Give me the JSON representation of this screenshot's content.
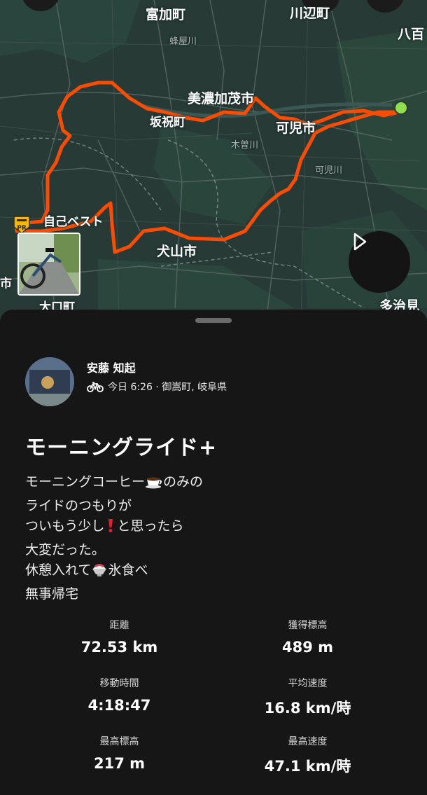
{
  "map": {
    "labels": {
      "tomikacho": "富加町",
      "kawabe": "川辺町",
      "hachiman": "八百",
      "minokamo": "美濃加茂市",
      "sakahogi": "坂祝町",
      "kani": "可児市",
      "kani_river": "可児川",
      "kiso_river": "木曽川",
      "hachiya_river": "蜂屋川",
      "inuyama": "犬山市",
      "pr_label": "自己ベスト",
      "oguchi": "大口町",
      "tajimi": "多治見",
      "left_city": "市"
    },
    "pr_badge": "PR",
    "colors": {
      "route": "#fc4c02",
      "start": "#8ee04c",
      "map_bg": "#273a36"
    }
  },
  "sheet": {
    "user": {
      "name": "安藤 知起",
      "avatar": "avatar-photo"
    },
    "activity_meta": {
      "icon": "bicycle-icon",
      "text": "今日 6:26 · 御嵩町, 岐阜県"
    },
    "title": "モーニングライド+",
    "description": {
      "line1_a": "モーニングコーヒー",
      "line1_b": "のみの",
      "line2": "ライドのつもりが",
      "line3_a": "ついもう少し",
      "line3_b": "と思ったら",
      "line4": "大変だった。",
      "line5_a": "休憩入れて",
      "line5_b": "氷食べ",
      "line6": "無事帰宅"
    },
    "stats": [
      {
        "label": "距離",
        "value": "72.53 km"
      },
      {
        "label": "獲得標高",
        "value": "489 m"
      },
      {
        "label": "移動時間",
        "value": "4:18:47"
      },
      {
        "label": "平均速度",
        "value": "16.8 km/時"
      },
      {
        "label": "最高標高",
        "value": "217 m"
      },
      {
        "label": "最高速度",
        "value": "47.1 km/時"
      }
    ]
  }
}
